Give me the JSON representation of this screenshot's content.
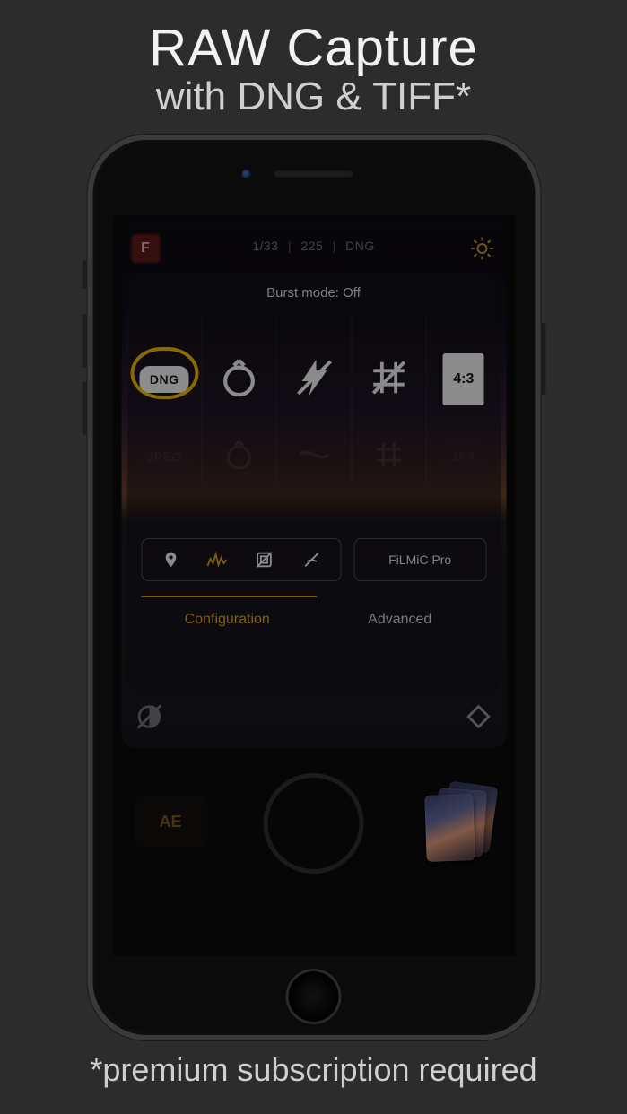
{
  "promo": {
    "title": "RAW Capture",
    "subtitle": "with DNG & TIFF*",
    "footnote": "*premium subscription required"
  },
  "topbar": {
    "shutter_speed": "1/33",
    "iso": "225",
    "format": "DNG"
  },
  "panel": {
    "burst_label": "Burst mode: Off",
    "format_selected": "DNG",
    "format_ghost": "JPEG",
    "ratio_selected": "4:3",
    "ratio_ghost": "16:9",
    "filmic_label": "FiLMiC Pro",
    "tabs": {
      "configuration": "Configuration",
      "advanced": "Advanced"
    }
  },
  "controls": {
    "ae_label": "AE"
  }
}
